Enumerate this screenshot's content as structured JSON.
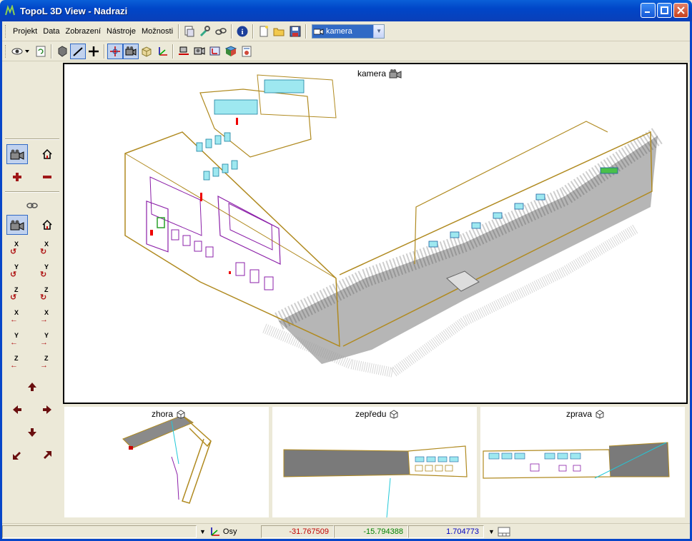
{
  "window": {
    "title": "TopoL 3D View - Nadrazi"
  },
  "menu": [
    "Projekt",
    "Data",
    "Zobrazení",
    "Nástroje",
    "Možnosti"
  ],
  "camera_select": {
    "value": "kamera"
  },
  "views": {
    "main": {
      "label": "kamera"
    },
    "top": {
      "label": "zhora"
    },
    "front": {
      "label": "zepředu"
    },
    "right": {
      "label": "zprava"
    }
  },
  "sidebar": {
    "rotate_x": "X",
    "rotate_y": "Y",
    "rotate_z": "Z"
  },
  "status": {
    "axes_label": "Osy",
    "x": "-31.767509",
    "y": "-15.794388",
    "z": "1.704773"
  },
  "colors": {
    "x_coord": "#c00000",
    "y_coord": "#008000",
    "z_coord": "#0000c0",
    "building_outline": "#b08a20",
    "windows": "#20c8d8"
  }
}
